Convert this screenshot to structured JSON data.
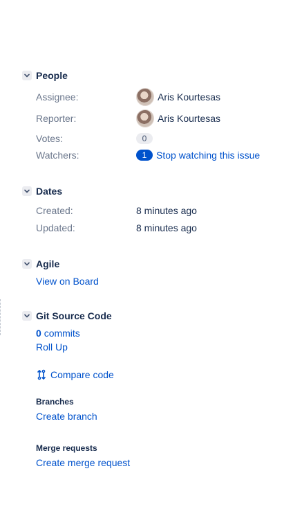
{
  "people": {
    "title": "People",
    "assignee_label": "Assignee:",
    "assignee_name": "Aris Kourtesas",
    "reporter_label": "Reporter:",
    "reporter_name": "Aris Kourtesas",
    "votes_label": "Votes:",
    "votes_count": "0",
    "watchers_label": "Watchers:",
    "watchers_count": "1",
    "watchers_action": "Stop watching this issue"
  },
  "dates": {
    "title": "Dates",
    "created_label": "Created:",
    "created_value": "8 minutes ago",
    "updated_label": "Updated:",
    "updated_value": "8 minutes ago"
  },
  "agile": {
    "title": "Agile",
    "view_on_board": "View on Board"
  },
  "git": {
    "title": "Git Source Code",
    "commits_count": "0",
    "commits_label": "commits",
    "roll_up": "Roll Up",
    "compare_code": "Compare code",
    "branches_heading": "Branches",
    "create_branch": "Create branch",
    "merge_heading": "Merge requests",
    "create_merge_request": "Create merge request"
  },
  "icons": {
    "section_toggle": "chevron-down-icon",
    "compare": "compare-arrows-icon",
    "avatar": "user-avatar"
  },
  "colors": {
    "link": "#0052cc",
    "label": "#6b778c",
    "text": "#172b4d",
    "badge_grey": "#ebecf0",
    "badge_blue": "#0052cc"
  }
}
